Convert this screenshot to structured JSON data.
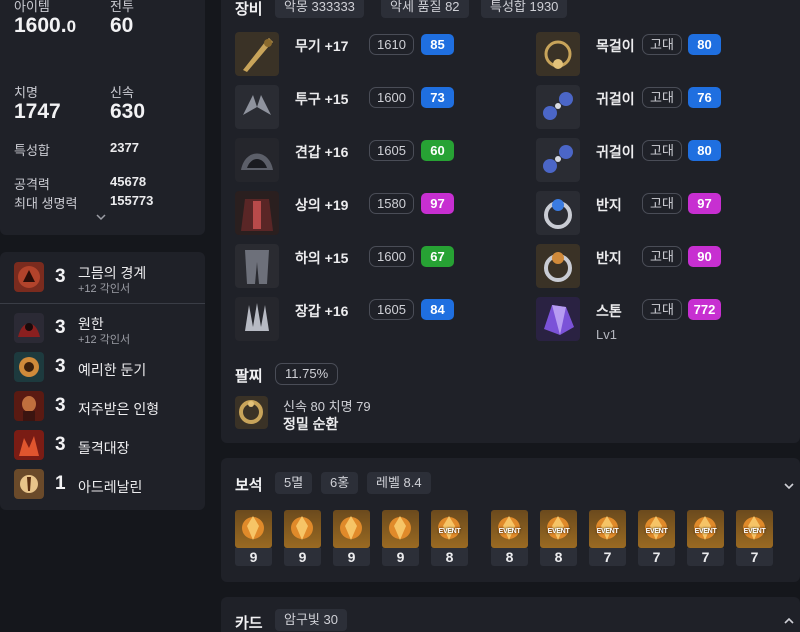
{
  "stats": {
    "item_level_label": "아이템",
    "item_level_int": "1600.",
    "item_level_dec": "0",
    "battle_level_label": "전투",
    "battle_level": "60",
    "crit_label": "치명",
    "crit": "1747",
    "swift_label": "신속",
    "swift": "630",
    "stat_sum_label": "특성합",
    "stat_sum": "2377",
    "attack_label": "공격력",
    "attack": "45678",
    "max_hp_label": "최대 생명력",
    "max_hp": "155773"
  },
  "engravings": [
    {
      "level": "3",
      "name": "그믐의 경계",
      "sub": "+12 각인서",
      "icon": "grudge-moon-icon"
    },
    {
      "level": "3",
      "name": "원한",
      "sub": "+12 각인서",
      "icon": "grudge-icon"
    },
    {
      "level": "3",
      "name": "예리한 둔기",
      "sub": "",
      "icon": "keen-blunt-icon"
    },
    {
      "level": "3",
      "name": "저주받은 인형",
      "sub": "",
      "icon": "cursed-doll-icon"
    },
    {
      "level": "3",
      "name": "돌격대장",
      "sub": "",
      "icon": "raid-captain-icon"
    },
    {
      "level": "1",
      "name": "아드레날린",
      "sub": "",
      "icon": "adrenaline-icon"
    }
  ],
  "equipment": {
    "title": "장비",
    "chips": [
      "악몽 333333",
      "악세 품질 82",
      "특성합 1930"
    ],
    "left": [
      {
        "name": "무기 +17",
        "ilvl": "1610",
        "quality": "85",
        "color": "#1f6fe0",
        "icon": "weapon-icon"
      },
      {
        "name": "투구 +15",
        "ilvl": "1600",
        "quality": "73",
        "color": "#1f6fe0",
        "icon": "helmet-icon"
      },
      {
        "name": "견갑 +16",
        "ilvl": "1605",
        "quality": "60",
        "color": "#27a234",
        "icon": "shoulder-icon"
      },
      {
        "name": "상의 +19",
        "ilvl": "1580",
        "quality": "97",
        "color": "#c72fd1",
        "icon": "chest-icon"
      },
      {
        "name": "하의 +15",
        "ilvl": "1600",
        "quality": "67",
        "color": "#27a234",
        "icon": "pants-icon"
      },
      {
        "name": "장갑 +16",
        "ilvl": "1605",
        "quality": "84",
        "color": "#1f6fe0",
        "icon": "gloves-icon"
      }
    ],
    "right": [
      {
        "name": "목걸이",
        "grade": "고대",
        "quality": "80",
        "color": "#1f6fe0",
        "icon": "necklace-icon"
      },
      {
        "name": "귀걸이",
        "grade": "고대",
        "quality": "76",
        "color": "#1f6fe0",
        "icon": "earring-icon"
      },
      {
        "name": "귀걸이",
        "grade": "고대",
        "quality": "80",
        "color": "#1f6fe0",
        "icon": "earring-icon"
      },
      {
        "name": "반지",
        "grade": "고대",
        "quality": "97",
        "color": "#c72fd1",
        "icon": "ring-icon"
      },
      {
        "name": "반지",
        "grade": "고대",
        "quality": "90",
        "color": "#c72fd1",
        "icon": "ring-icon"
      },
      {
        "name": "스톤",
        "grade": "고대",
        "quality": "772",
        "color": "#c72fd1",
        "sub": "Lv1",
        "icon": "stone-icon"
      }
    ],
    "bracelet": {
      "title": "팔찌",
      "percent": "11.75%",
      "stats": "신속 80  치명 79",
      "effect": "정밀  순환",
      "icon": "bracelet-icon"
    }
  },
  "gems": {
    "title": "보석",
    "chips": [
      "5멸",
      "6홍",
      "레벨 8.4"
    ],
    "event_label": "EVENT",
    "items": [
      {
        "level": "9",
        "event": false
      },
      {
        "level": "9",
        "event": false
      },
      {
        "level": "9",
        "event": false
      },
      {
        "level": "9",
        "event": false
      },
      {
        "level": "8",
        "event": true
      },
      {
        "level": "8",
        "event": true
      },
      {
        "level": "8",
        "event": true
      },
      {
        "level": "7",
        "event": true
      },
      {
        "level": "7",
        "event": true
      },
      {
        "level": "7",
        "event": true
      },
      {
        "level": "7",
        "event": true
      }
    ]
  },
  "cards": {
    "title": "카드",
    "chip": "암구빛 30"
  }
}
